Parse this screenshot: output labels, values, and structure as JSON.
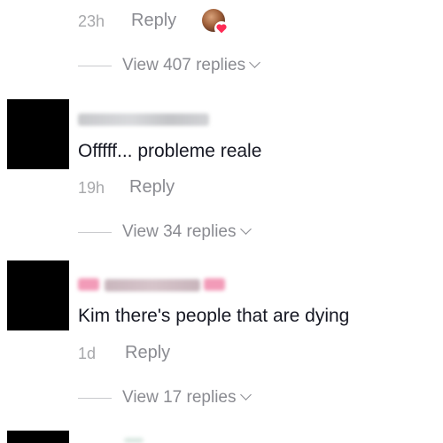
{
  "comments": [
    {
      "time": "23h",
      "reply_label": "Reply",
      "view_replies": "View 407 replies"
    },
    {
      "text": "Offfff... probleme reale",
      "time": "19h",
      "reply_label": "Reply",
      "view_replies": "View 34 replies"
    },
    {
      "text": "Kim there's people that are dying",
      "time": "1d",
      "reply_label": "Reply",
      "view_replies": "View 17 replies"
    }
  ]
}
